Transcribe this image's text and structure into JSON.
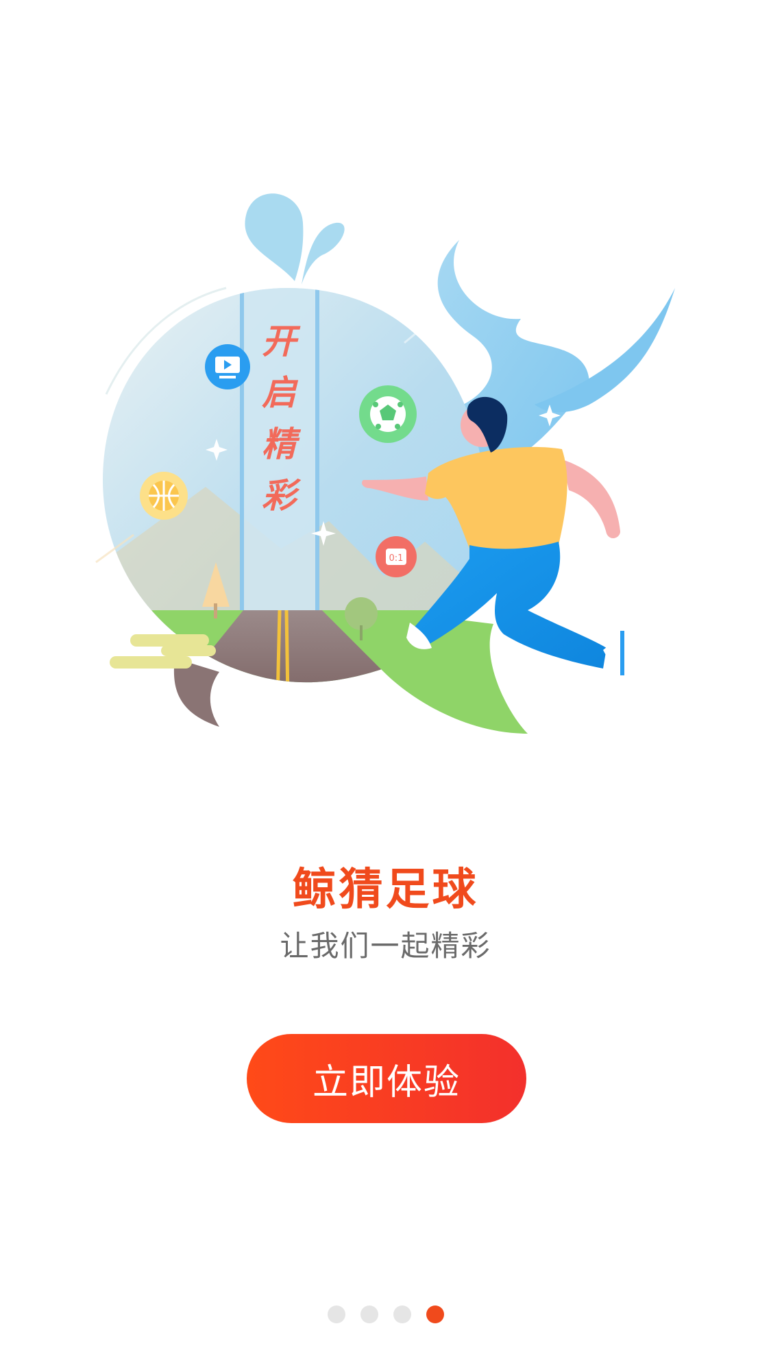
{
  "illustration": {
    "banner_chars": [
      "开",
      "启",
      "精",
      "彩"
    ],
    "score_badge": "0:1",
    "icons": [
      "tv-icon",
      "soccer-ball-icon",
      "basketball-icon",
      "scoreboard-icon"
    ]
  },
  "onboarding": {
    "title": "鲸猜足球",
    "subtitle": "让我们一起精彩",
    "cta_label": "立即体验"
  },
  "pager": {
    "total": 4,
    "current": 4
  },
  "colors": {
    "accent": "#f04a1c",
    "button_gradient_start": "#ff4a18",
    "button_gradient_end": "#f3302c",
    "subtitle": "#6a6a6a",
    "dot_inactive": "#e5e5e5"
  }
}
